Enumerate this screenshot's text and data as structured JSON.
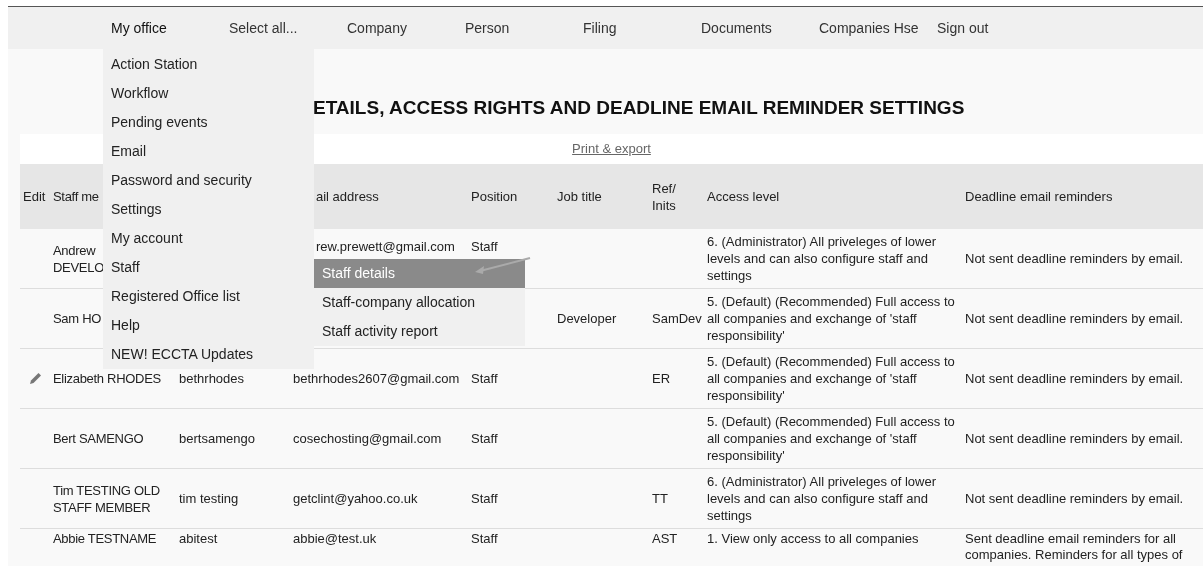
{
  "nav": [
    {
      "label": "My office",
      "selected": true
    },
    {
      "label": "Select all...",
      "selected": false
    },
    {
      "label": "Company",
      "selected": false
    },
    {
      "label": "Person",
      "selected": false
    },
    {
      "label": "Filing",
      "selected": false
    },
    {
      "label": "Documents",
      "selected": false
    },
    {
      "label": "Companies Hse",
      "selected": false
    },
    {
      "label": "Sign out",
      "selected": false
    }
  ],
  "menu": {
    "items": [
      {
        "label": "Action Station",
        "selected": false
      },
      {
        "label": "Workflow",
        "selected": false
      },
      {
        "label": "Pending events",
        "selected": false
      },
      {
        "label": "Email",
        "selected": false
      },
      {
        "label": "Password and security",
        "selected": false
      },
      {
        "label": "Settings",
        "selected": false
      },
      {
        "label": "My account",
        "selected": false
      },
      {
        "label": "Staff",
        "selected": false
      },
      {
        "label": "Registered Office list",
        "selected": false
      },
      {
        "label": "Help",
        "selected": false
      },
      {
        "label": "NEW! ECCTA Updates",
        "selected": false
      }
    ],
    "submenu": [
      {
        "label": "Staff details",
        "selected": true
      },
      {
        "label": "Staff-company allocation",
        "selected": false
      },
      {
        "label": "Staff activity report",
        "selected": false
      }
    ]
  },
  "page_title": "ETAILS, ACCESS RIGHTS AND DEADLINE EMAIL REMINDER SETTINGS",
  "print_link": "Print & export",
  "table": {
    "columns": {
      "edit": "Edit",
      "name": "Staff me",
      "email": "ail address",
      "position": "Position",
      "job_title": "Job title",
      "ref": [
        "Ref/",
        "Inits"
      ],
      "access": "Access level",
      "deadline": "Deadline email reminders"
    },
    "rows": [
      {
        "edit_icon": false,
        "name": [
          "Andrew",
          "DEVELO"
        ],
        "email": "rew.prewett@gmail.com",
        "position": "Staff",
        "access": "6. (Administrator) All priveleges of lower levels and can also configure staff and settings",
        "deadline": "Not sent deadline reminders by email."
      },
      {
        "edit_icon": false,
        "name": [
          "Sam HO"
        ],
        "job_title": "Developer",
        "ref": "SamDev",
        "access": "5. (Default) (Recommended) Full access to all companies and exchange of 'staff responsibility'",
        "deadline": "Not sent deadline reminders by email."
      },
      {
        "edit_icon": true,
        "name": [
          "Elizabeth RHODES"
        ],
        "username": "bethrhodes",
        "email": "bethrhodes2607@gmail.com",
        "position": "Staff",
        "ref": "ER",
        "access": "5. (Default) (Recommended) Full access to all companies and exchange of 'staff responsibility'",
        "deadline": "Not sent deadline reminders by email."
      },
      {
        "edit_icon": false,
        "name": [
          "Bert SAMENGO"
        ],
        "username": "bertsamengo",
        "email": "cosechosting@gmail.com",
        "position": "Staff",
        "access": "5. (Default) (Recommended) Full access to all companies and exchange of 'staff responsibility'",
        "deadline": "Not sent deadline reminders by email."
      },
      {
        "edit_icon": false,
        "name": [
          "Tim TESTING OLD",
          "STAFF MEMBER"
        ],
        "username": "tim testing",
        "email": "getclint@yahoo.co.uk",
        "position": "Staff",
        "ref": "TT",
        "access": "6. (Administrator) All priveleges of lower levels and can also configure staff and settings",
        "deadline": "Not sent deadline reminders by email."
      },
      {
        "edit_icon": false,
        "name": [
          "Abbie TESTNAME"
        ],
        "username": "abitest",
        "email": "abbie@test.uk",
        "position": "Staff",
        "ref": "AST",
        "access": "1. View only access to all companies",
        "deadline": "Sent deadline email reminders for all companies. Reminders for all types of"
      }
    ]
  }
}
